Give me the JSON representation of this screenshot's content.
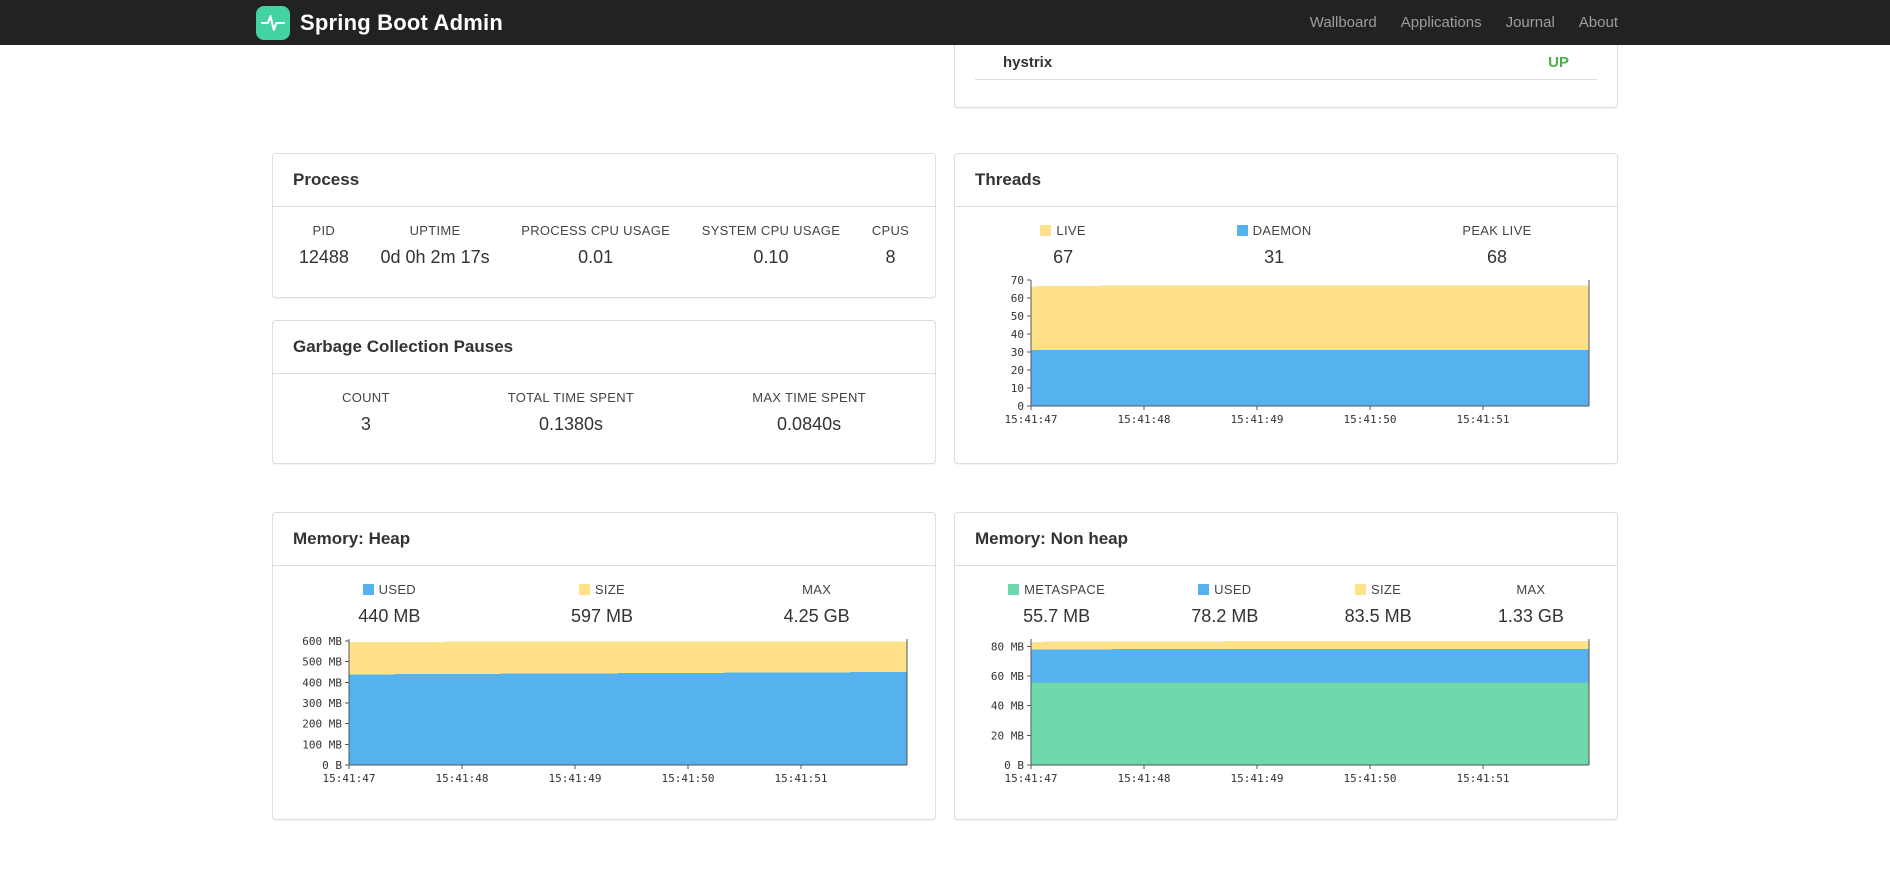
{
  "colors": {
    "navbar_bg": "#222222",
    "brand": "#42d3a0",
    "status_up": "#4cae4c",
    "series_yellow": "#ffe18a",
    "series_blue": "#55b2ee",
    "series_green": "#6fd9ae"
  },
  "navbar": {
    "brand": "Spring Boot Admin",
    "links": [
      {
        "label": "Wallboard"
      },
      {
        "label": "Applications"
      },
      {
        "label": "Journal"
      },
      {
        "label": "About"
      }
    ]
  },
  "applications": {
    "rows": [
      {
        "name": "hystrix",
        "status": "UP"
      }
    ]
  },
  "process": {
    "title": "Process",
    "metrics": [
      {
        "label": "PID",
        "value": "12488"
      },
      {
        "label": "UPTIME",
        "value": "0d 0h 2m 17s"
      },
      {
        "label": "PROCESS CPU USAGE",
        "value": "0.01"
      },
      {
        "label": "SYSTEM CPU USAGE",
        "value": "0.10"
      },
      {
        "label": "CPUS",
        "value": "8"
      }
    ]
  },
  "gc": {
    "title": "Garbage Collection Pauses",
    "metrics": [
      {
        "label": "COUNT",
        "value": "3"
      },
      {
        "label": "TOTAL TIME SPENT",
        "value": "0.1380s"
      },
      {
        "label": "MAX TIME SPENT",
        "value": "0.0840s"
      }
    ]
  },
  "threads": {
    "title": "Threads",
    "legend": [
      {
        "label": "LIVE",
        "value": "67",
        "color": "#ffe18a"
      },
      {
        "label": "DAEMON",
        "value": "31",
        "color": "#55b2ee"
      },
      {
        "label": "PEAK LIVE",
        "value": "68",
        "color": ""
      }
    ],
    "chart": {
      "type": "area",
      "ymax": 70,
      "yticks": [
        {
          "v": 0,
          "label": "0"
        },
        {
          "v": 10,
          "label": "10"
        },
        {
          "v": 20,
          "label": "20"
        },
        {
          "v": 30,
          "label": "30"
        },
        {
          "v": 40,
          "label": "40"
        },
        {
          "v": 50,
          "label": "50"
        },
        {
          "v": 60,
          "label": "60"
        },
        {
          "v": 70,
          "label": "70"
        }
      ],
      "x_labels": [
        "15:41:47",
        "15:41:48",
        "15:41:49",
        "15:41:50",
        "15:41:51"
      ],
      "xtick_span": 0.81,
      "series": [
        {
          "name": "LIVE",
          "color": "#ffe18a",
          "values": [
            66.5,
            67,
            67,
            67,
            67,
            67
          ]
        },
        {
          "name": "DAEMON",
          "color": "#55b2ee",
          "values": [
            31,
            31,
            31,
            31,
            31,
            31
          ]
        }
      ]
    }
  },
  "heap": {
    "title": "Memory: Heap",
    "legend": [
      {
        "label": "USED",
        "value": "440 MB",
        "color": "#55b2ee"
      },
      {
        "label": "SIZE",
        "value": "597 MB",
        "color": "#ffe18a"
      },
      {
        "label": "MAX",
        "value": "4.25 GB",
        "color": ""
      }
    ],
    "chart": {
      "type": "area",
      "ymax": 610,
      "yticks": [
        {
          "v": 0,
          "label": "0 B"
        },
        {
          "v": 100,
          "label": "100 MB"
        },
        {
          "v": 200,
          "label": "200 MB"
        },
        {
          "v": 300,
          "label": "300 MB"
        },
        {
          "v": 400,
          "label": "400 MB"
        },
        {
          "v": 500,
          "label": "500 MB"
        },
        {
          "v": 600,
          "label": "600 MB"
        }
      ],
      "x_labels": [
        "15:41:47",
        "15:41:48",
        "15:41:49",
        "15:41:50",
        "15:41:51"
      ],
      "xtick_span": 0.81,
      "series": [
        {
          "name": "SIZE",
          "color": "#ffe18a",
          "values": [
            595,
            597,
            597,
            597,
            597,
            597
          ]
        },
        {
          "name": "USED",
          "color": "#55b2ee",
          "values": [
            438,
            441,
            443,
            446,
            448,
            450
          ]
        }
      ]
    }
  },
  "nonheap": {
    "title": "Memory: Non heap",
    "legend": [
      {
        "label": "METASPACE",
        "value": "55.7 MB",
        "color": "#6fd9ae"
      },
      {
        "label": "USED",
        "value": "78.2 MB",
        "color": "#55b2ee"
      },
      {
        "label": "SIZE",
        "value": "83.5 MB",
        "color": "#ffe18a"
      },
      {
        "label": "MAX",
        "value": "1.33 GB",
        "color": ""
      }
    ],
    "chart": {
      "type": "area",
      "ymax": 85,
      "yticks": [
        {
          "v": 0,
          "label": "0 B"
        },
        {
          "v": 20,
          "label": "20 MB"
        },
        {
          "v": 40,
          "label": "40 MB"
        },
        {
          "v": 60,
          "label": "60 MB"
        },
        {
          "v": 80,
          "label": "80 MB"
        }
      ],
      "x_labels": [
        "15:41:47",
        "15:41:48",
        "15:41:49",
        "15:41:50",
        "15:41:51"
      ],
      "xtick_span": 0.81,
      "series": [
        {
          "name": "SIZE",
          "color": "#ffe18a",
          "values": [
            83.1,
            83.4,
            83.5,
            83.5,
            83.5,
            83.5
          ]
        },
        {
          "name": "USED",
          "color": "#55b2ee",
          "values": [
            78.0,
            78.1,
            78.2,
            78.2,
            78.2,
            78.2
          ]
        },
        {
          "name": "METASPACE",
          "color": "#6fd9ae",
          "values": [
            55.7,
            55.7,
            55.7,
            55.7,
            55.7,
            55.7
          ]
        }
      ]
    }
  }
}
